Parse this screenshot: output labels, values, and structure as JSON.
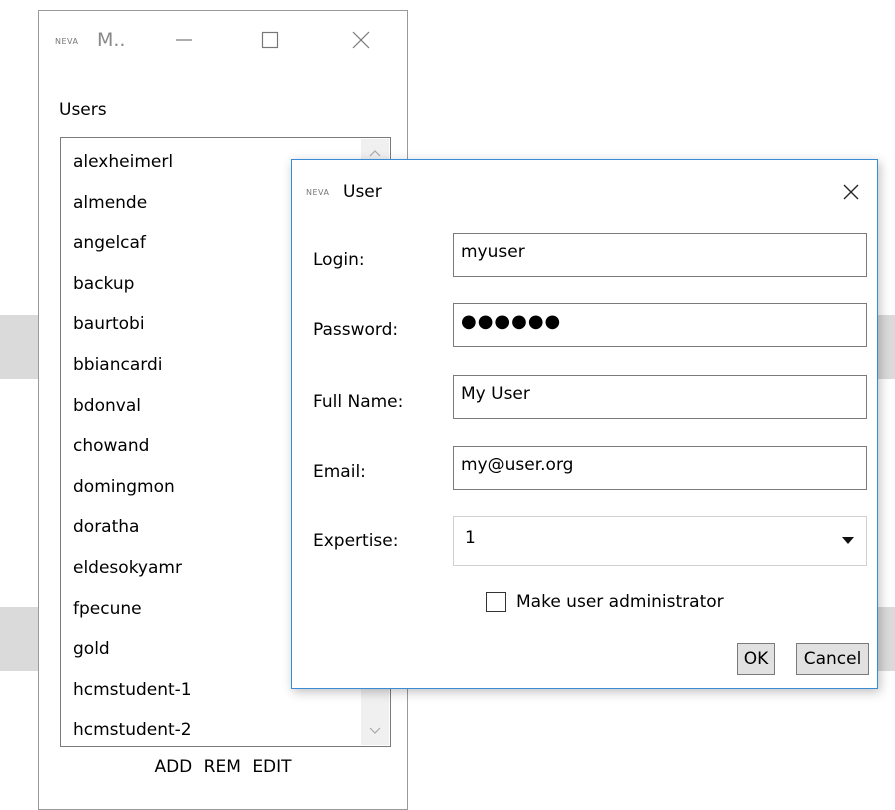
{
  "main_window": {
    "app_logo": "NEVA",
    "title": "M..",
    "users_label": "Users",
    "users": [
      "alexheimerl",
      "almende",
      "angelcaf",
      "backup",
      "baurtobi",
      "bbiancardi",
      "bdonval",
      "chowand",
      "domingmon",
      "doratha",
      "eldesokyamr",
      "fpecune",
      "gold",
      "hcmstudent-1",
      "hcmstudent-2"
    ],
    "actions": {
      "add": "ADD",
      "rem": "REM",
      "edit": "EDIT"
    }
  },
  "dialog": {
    "app_logo": "NEVA",
    "title": "User",
    "fields": {
      "login": {
        "label": "Login:",
        "value": "myuser"
      },
      "password": {
        "label": "Password:",
        "value": "●●●●●●"
      },
      "full_name": {
        "label": "Full Name:",
        "value": "My User"
      },
      "email": {
        "label": "Email:",
        "value": "my@user.org"
      },
      "expertise": {
        "label": "Expertise:",
        "value": "1"
      }
    },
    "admin_checkbox": {
      "label": "Make user administrator",
      "checked": false
    },
    "ok_label": "OK",
    "cancel_label": "Cancel"
  },
  "colors": {
    "dialog_border": "#3a8ad6",
    "background_strip": "#dadada",
    "button_face": "#e1e1e1"
  },
  "icons": {
    "minimize": "minimize-icon",
    "maximize": "maximize-icon",
    "close": "close-icon",
    "scroll_up": "chevron-up-icon",
    "scroll_down": "chevron-down-icon",
    "dropdown": "caret-down-icon"
  }
}
